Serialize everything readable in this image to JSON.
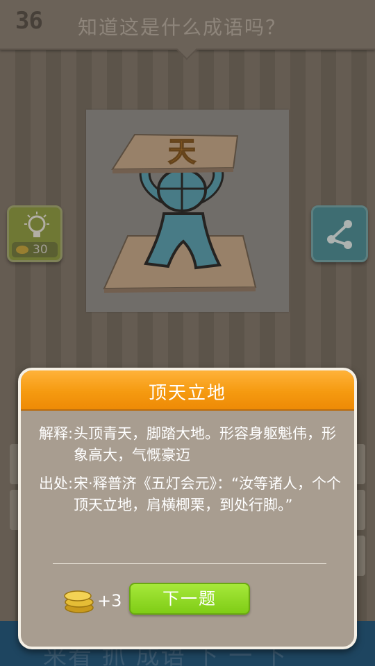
{
  "header": {
    "level": "36",
    "question": "知道这是什么成语吗？"
  },
  "picture": {
    "glyph": "天"
  },
  "hint": {
    "icon": "lightbulb-icon",
    "cost": "30"
  },
  "share": {
    "icon": "share-icon"
  },
  "banner": {
    "text": "来看 抓 成语 下 一 下"
  },
  "dialog": {
    "title": "顶天立地",
    "explain_label": "解释:",
    "explain_text": "头顶青天，脚踏大地。形容身躯魁伟，形象高大，气慨豪迈",
    "source_label": "出处:",
    "source_text": "宋·释普济《五灯会元》：“汝等诸人，个个顶天立地，肩横楖栗，到处行脚。”",
    "reward": "+3",
    "next_label": "下一题"
  },
  "colors": {
    "header_bg": "#857a6e",
    "dialog_head": "#f59a10",
    "next_button": "#7fcc16",
    "hint_button": "#8a9b37",
    "share_button": "#3f8b95",
    "banner": "#0f4d7a"
  }
}
